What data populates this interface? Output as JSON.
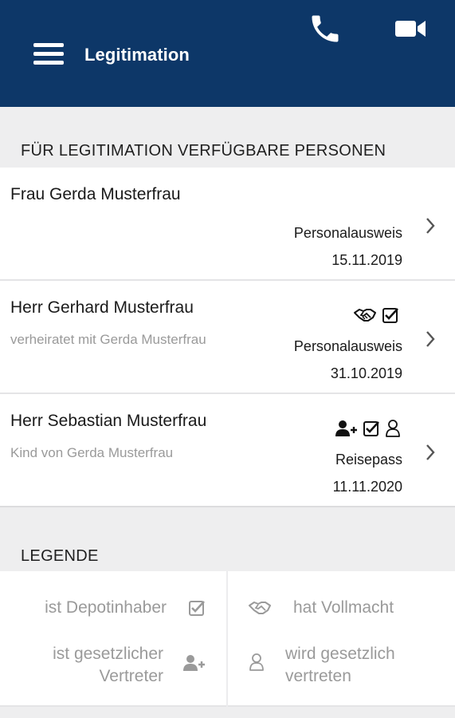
{
  "appbar": {
    "title": "Legitimation",
    "icons": [
      "menu-icon",
      "phone-icon",
      "video-camera-icon"
    ],
    "color": "#0d3768"
  },
  "persons_section": {
    "header": "FÜR LEGITIMATION VERFÜGBARE PERSONEN",
    "persons": [
      {
        "name": "Frau Gerda Musterfrau",
        "relation": "",
        "icons": [],
        "document": "Personalausweis",
        "date": "15.11.2019"
      },
      {
        "name": "Herr Gerhard Musterfrau",
        "relation": "verheiratet mit Gerda Musterfrau",
        "icons": [
          "handshake-icon",
          "checkbox-icon"
        ],
        "document": "Personalausweis",
        "date": "31.10.2019"
      },
      {
        "name": "Herr Sebastian Musterfrau",
        "relation": "Kind von Gerda Musterfrau",
        "icons": [
          "user-plus-icon",
          "checkbox-icon",
          "user-outline-icon"
        ],
        "document": "Reisepass",
        "date": "11.11.2020"
      }
    ]
  },
  "legend": {
    "header": "LEGENDE",
    "items": [
      {
        "label": "ist Depotinhaber",
        "icon": "checkbox-icon"
      },
      {
        "label": "hat Vollmacht",
        "icon": "handshake-icon"
      },
      {
        "label_line1": "ist gesetzlicher",
        "label_line2": "Vertreter",
        "icon": "user-plus-icon"
      },
      {
        "label_line1": "wird gesetzlich",
        "label_line2": "vertreten",
        "icon": "user-outline-icon"
      }
    ]
  }
}
